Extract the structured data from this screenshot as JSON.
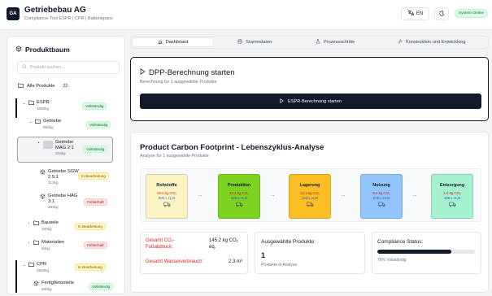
{
  "header": {
    "logo_text": "GA",
    "company": "Getriebebau AG",
    "subtitle": "Compliance-Tool ESPR | CPR | Batteriepass",
    "language": "EN",
    "system_status": "System Online"
  },
  "sidebar": {
    "title": "Produktbaum",
    "search_placeholder": "Produkt suchen...",
    "all_products_label": "Alle Produkte",
    "all_products_count": "22",
    "tree": {
      "espr": {
        "name": "ESPR",
        "meta": "1052kg",
        "status": "Vollständig"
      },
      "getriebe": {
        "name": "Getriebe",
        "meta": "850kg",
        "status": "Vollständig"
      },
      "mag": {
        "name": "Getriebe MAG 2:1",
        "meta": "233kg",
        "status": "Vollständig"
      },
      "sgw": {
        "name": "Getriebe SGW 2.5:1",
        "meta": "312kg",
        "status": "In Bearbeitung"
      },
      "hag": {
        "name": "Getriebe HAG 3:1",
        "meta": "283kg",
        "status": "Fehlerhaft"
      },
      "bauteile": {
        "name": "Bauteile",
        "meta": "150kg",
        "status": "In Bearbeitung"
      },
      "materialien": {
        "name": "Materialien",
        "meta": "52kg",
        "status": "Fehlerhaft"
      },
      "cpr": {
        "name": "CPR",
        "meta": "2840kg",
        "status": "In Bearbeitung"
      },
      "fertig": {
        "name": "Fertigbetonteile",
        "meta": "890kg",
        "status": "Vollständig"
      }
    }
  },
  "tabs": [
    {
      "label": "Dashboard",
      "icon": "chart-icon"
    },
    {
      "label": "Stammdaten",
      "icon": "database-icon"
    },
    {
      "label": "Prozessschritte",
      "icon": "flask-icon"
    },
    {
      "label": "Konstruktion und Entwicklung",
      "icon": "wrench-icon"
    }
  ],
  "dpp": {
    "title": "DPP-Berechnung starten",
    "subtitle": "Berechnung für 1 ausgewählte Produkte",
    "button": "ESPR-Berechnung starten"
  },
  "pcf": {
    "title": "Product Carbon Footprint - Lebenszyklus-Analyse",
    "subtitle": "Analyse für 1 ausgewählte Produkte",
    "phases": [
      {
        "name": "Rohstoffe",
        "co2": "39.5 kg CO₂",
        "water": "890 L H₂O",
        "bg": "#fdf4c4",
        "co2_color": "#dc2626",
        "water_color": "#2563eb"
      },
      {
        "name": "Produktion",
        "co2": "34.2 kg CO₂",
        "water": "420 L H₂O",
        "bg": "#7ed321",
        "co2_color": "#b91c1c",
        "water_color": "#1d4ed8"
      },
      {
        "name": "Lagerung",
        "co2": "12.1 kg CO₂",
        "water": "123 L H₂O",
        "bg": "#fbbf24",
        "co2_color": "#b91c1c",
        "water_color": "#1d4ed8"
      },
      {
        "name": "Nutzung",
        "co2": "8.4 kg CO₂",
        "water": "678 L H₂O",
        "bg": "#93c5fd",
        "co2_color": "#b91c1c",
        "water_color": "#1d4ed8"
      },
      {
        "name": "Entsorgung",
        "co2": "1.0 kg CO₂",
        "water": "185 L H₂O",
        "bg": "#a7f3d0",
        "co2_color": "#b91c1c",
        "water_color": "#1d4ed8"
      }
    ],
    "footprint_label": "Gesamt CO₂-Fußabdruck:",
    "footprint_value": "145.2 kg CO₂ eq.",
    "water_label": "Gesamt Wasserverbrauch:",
    "water_value": "2.3 m³",
    "selected_label": "Ausgewählte Produkte:",
    "selected_value": "1",
    "selected_sub": "Produkte in Analyse",
    "compliance_label": "Compliance Status:",
    "compliance_pct": 76,
    "compliance_text": "76% Vollständig"
  }
}
